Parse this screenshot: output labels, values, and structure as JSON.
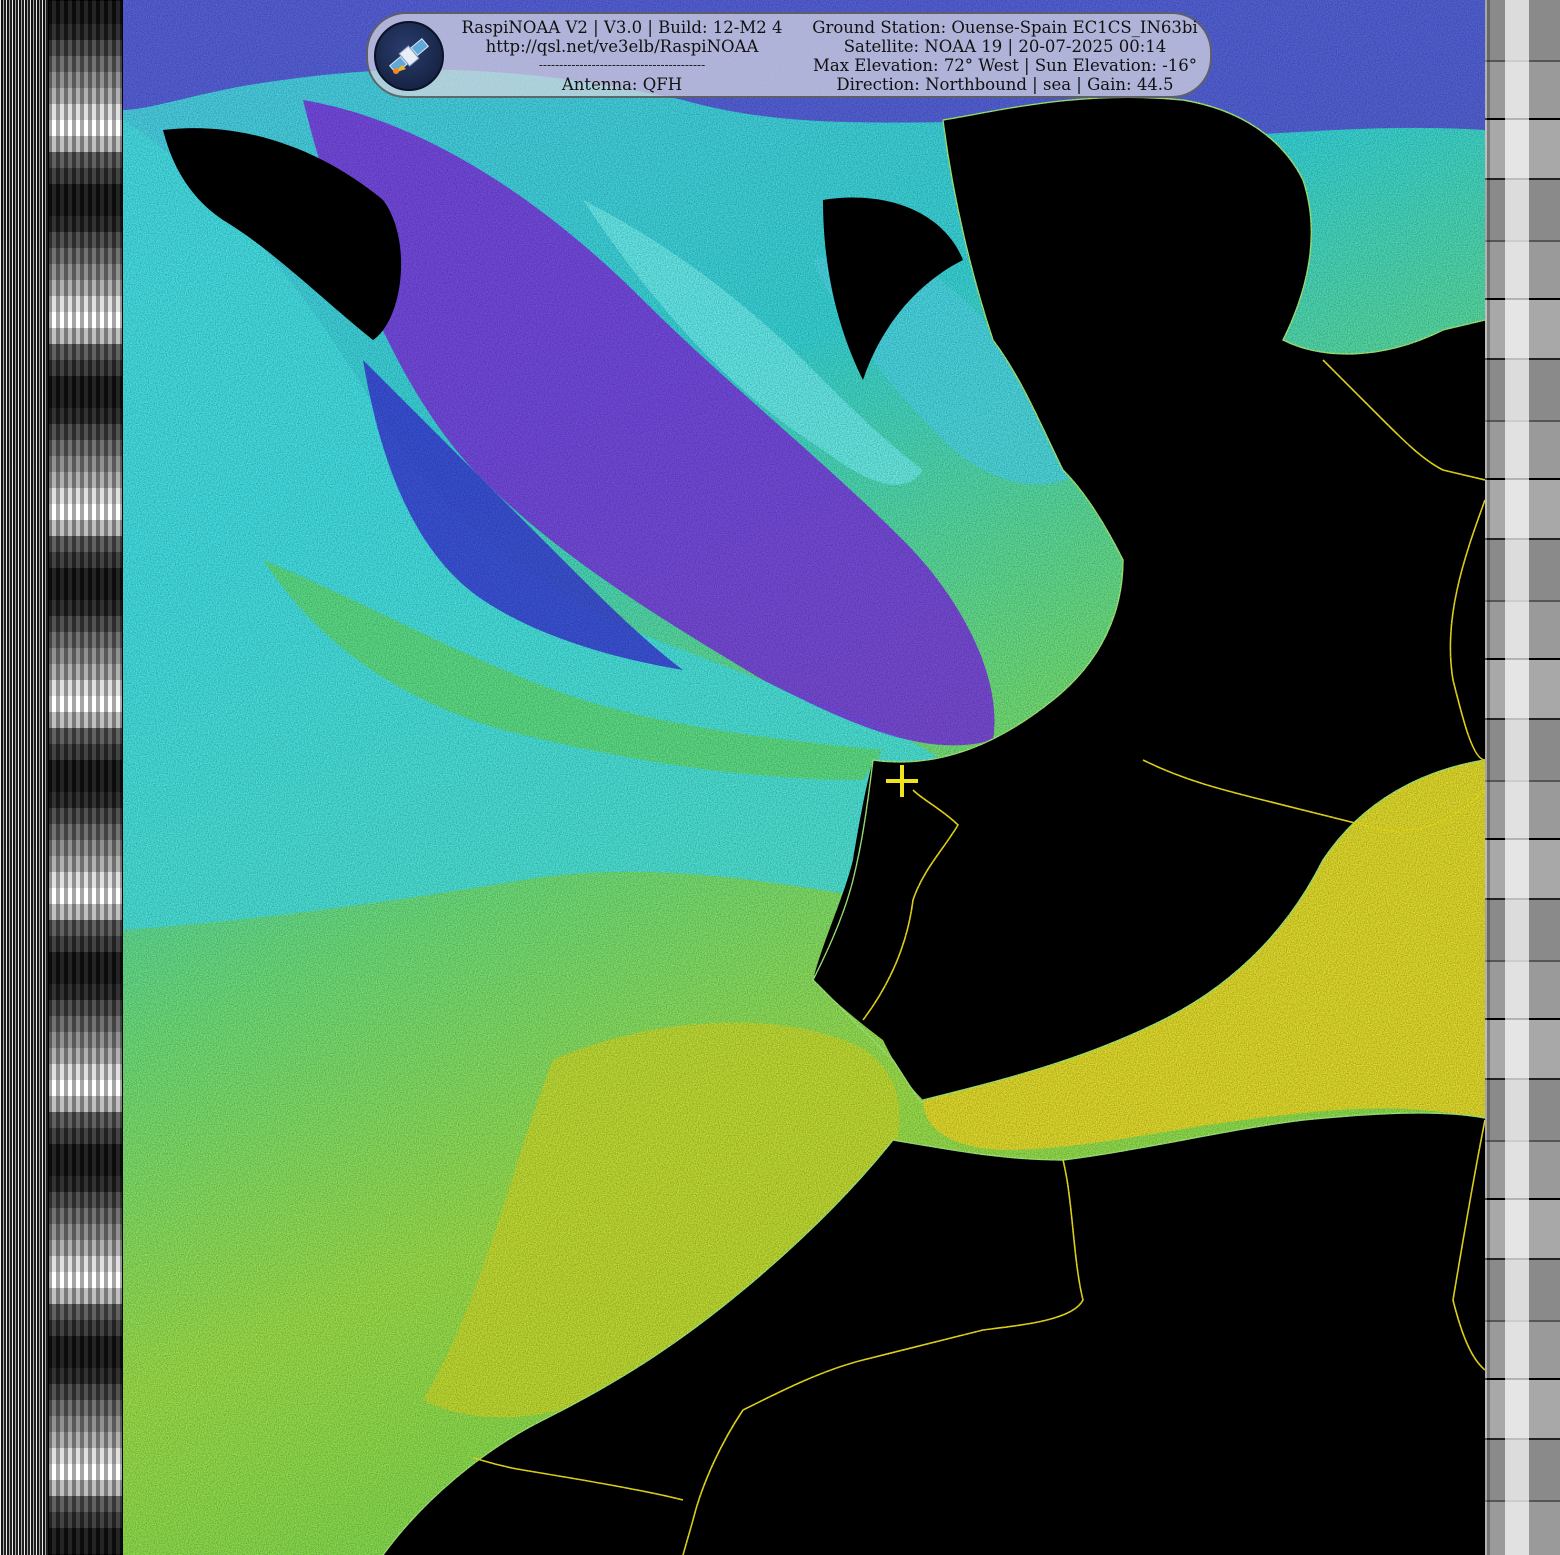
{
  "banner": {
    "app_line": "RaspiNOAA V2 | V3.0 | Build: 12-M2 4",
    "url_line": "http://qsl.net/ve3elb/RaspiNOAA",
    "divider": "-----------------------------------------",
    "antenna_line": "Antenna: QFH",
    "station_line": "Ground Station: Ouense-Spain EC1CS_IN63bi",
    "satellite_line": "Satellite: NOAA 19 | 20-07-2025 00:14",
    "elevation_line": "Max Elevation: 72° West | Sun Elevation: -16°",
    "direction_line": "Direction: Northbound | sea | Gain: 44.5"
  },
  "icons": {
    "logo": "satellite-icon",
    "station_marker": "crosshair-icon"
  },
  "colors": {
    "border_lines": "#f2e41c",
    "coastlines": "#a6f07a",
    "land": "#000000"
  }
}
